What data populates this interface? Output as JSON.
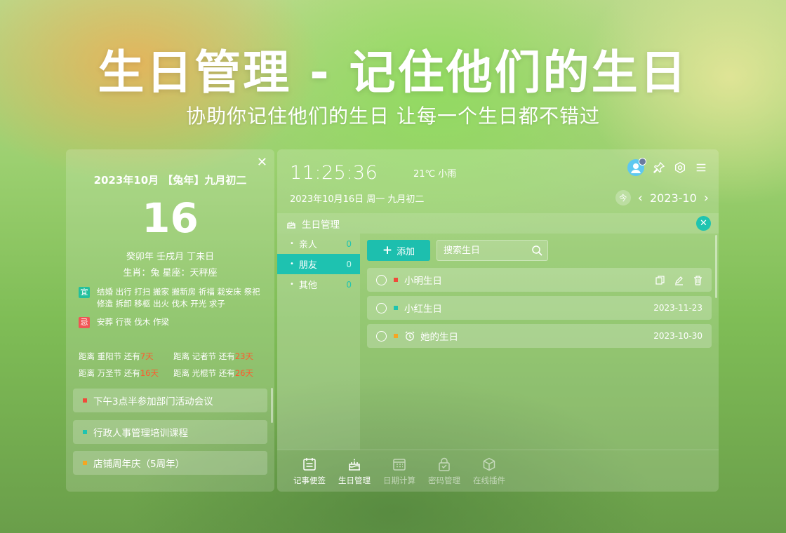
{
  "hero": {
    "title": "生日管理 - 记住他们的生日",
    "subtitle": "协助你记住他们的生日 让每一个生日都不错过"
  },
  "calendar": {
    "close_label": "✕",
    "date_line": "2023年10月 【兔年】九月初二",
    "day": "16",
    "lunar_line": "癸卯年 壬戌月 丁未日",
    "zodiac_line": "生肖：兔   星座：天秤座",
    "yi_label": "宜",
    "yi_text": "结婚 出行 打扫 搬家 搬新房 祈福 栽安床 祭祀 修造 拆卸 移柩 出火 伐木 开光 求子",
    "ji_label": "忌",
    "ji_text": "安葬 行丧 伐木 作梁",
    "countdowns": [
      {
        "prefix": "距离 重阳节 还有",
        "days": "7天"
      },
      {
        "prefix": "距离 记者节 还有",
        "days": "23天"
      },
      {
        "prefix": "距离 万圣节 还有",
        "days": "16天"
      },
      {
        "prefix": "距离 光棍节 还有",
        "days": "26天"
      }
    ],
    "notes": [
      {
        "text": "下午3点半参加部门活动会议",
        "color": "#f04a3a"
      },
      {
        "text": "行政人事管理培训课程",
        "color": "#1fc4b0"
      },
      {
        "text": "店铺周年庆（5周年）",
        "color": "#f5a623"
      }
    ]
  },
  "header": {
    "time": "11:25:36",
    "weather": "21℃  小雨",
    "full_date": "2023年10月16日 周一 九月初二",
    "today_label": "今",
    "month": "2023-10"
  },
  "module": {
    "title": "生日管理",
    "close_label": "✕"
  },
  "groups": [
    {
      "label": "亲人",
      "count": "0"
    },
    {
      "label": "朋友",
      "count": "0"
    },
    {
      "label": "其他",
      "count": "0"
    }
  ],
  "toolbar": {
    "add_label": "添加",
    "search_placeholder": "搜索生日"
  },
  "birthdays": [
    {
      "name": "小明生日",
      "date": "",
      "color": "#f04a3a"
    },
    {
      "name": "小红生日",
      "date": "2023-11-23",
      "color": "#1fc4b0"
    },
    {
      "name": "她的生日",
      "date": "2023-10-30",
      "color": "#f5a623"
    }
  ],
  "tabs": [
    {
      "label": "记事便签",
      "icon": "notes-icon"
    },
    {
      "label": "生日管理",
      "icon": "cake-icon"
    },
    {
      "label": "日期计算",
      "icon": "calendar-grid-icon"
    },
    {
      "label": "密码管理",
      "icon": "lock-icon"
    },
    {
      "label": "在线插件",
      "icon": "cube-icon"
    }
  ],
  "colors": {
    "accent": "#1fc4b0",
    "countdown_red": "#ff5a2e",
    "yi": "#24c09d",
    "ji": "#f05555"
  }
}
